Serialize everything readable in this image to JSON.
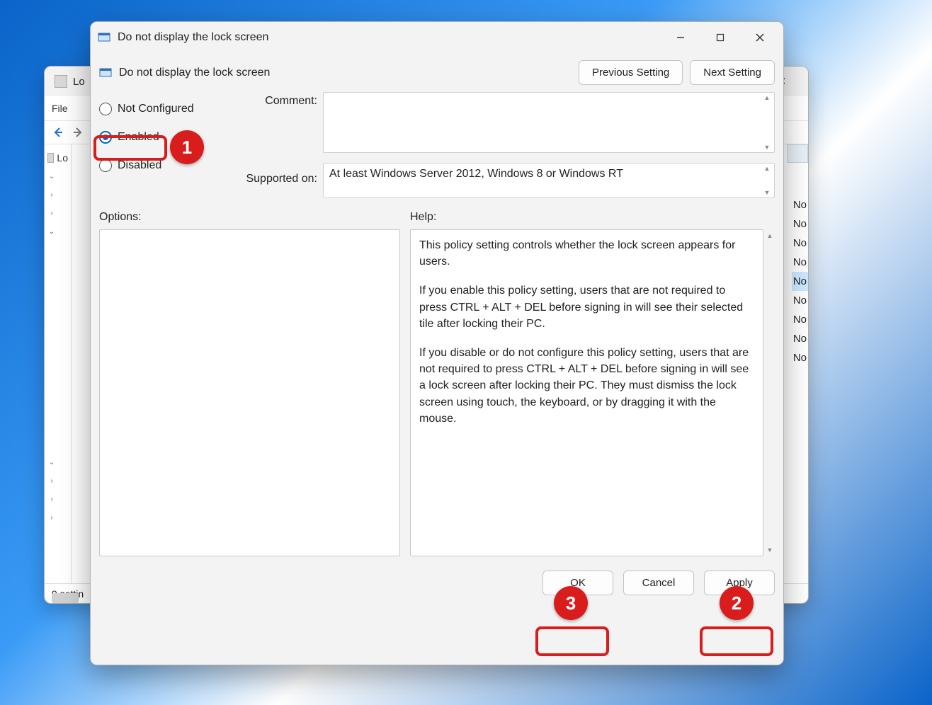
{
  "bg": {
    "title_fragment": "Lo",
    "menu_file": "File",
    "tree_label_fragment": "Lo",
    "list_item_fragment": "No",
    "status": "9 settin"
  },
  "dlg": {
    "title": "Do not display the lock screen",
    "policy_title": "Do not display the lock screen",
    "prev_button": "Previous Setting",
    "next_button": "Next Setting",
    "opt_not_configured": "Not Configured",
    "opt_enabled": "Enabled",
    "opt_disabled": "Disabled",
    "comment_label": "Comment:",
    "comment_value": "",
    "supported_label": "Supported on:",
    "supported_value": "At least Windows Server 2012, Windows 8 or Windows RT",
    "options_label": "Options:",
    "help_label": "Help:",
    "help_p1": "This policy setting controls whether the lock screen appears for users.",
    "help_p2": "If you enable this policy setting, users that are not required to press CTRL + ALT + DEL before signing in will see their selected tile after locking their PC.",
    "help_p3": "If you disable or do not configure this policy setting, users that are not required to press CTRL + ALT + DEL before signing in will see a lock screen after locking their PC. They must dismiss the lock screen using touch, the keyboard, or by dragging it with the mouse.",
    "ok": "OK",
    "cancel": "Cancel",
    "apply": "Apply"
  },
  "callouts": {
    "c1": "1",
    "c2": "2",
    "c3": "3"
  }
}
